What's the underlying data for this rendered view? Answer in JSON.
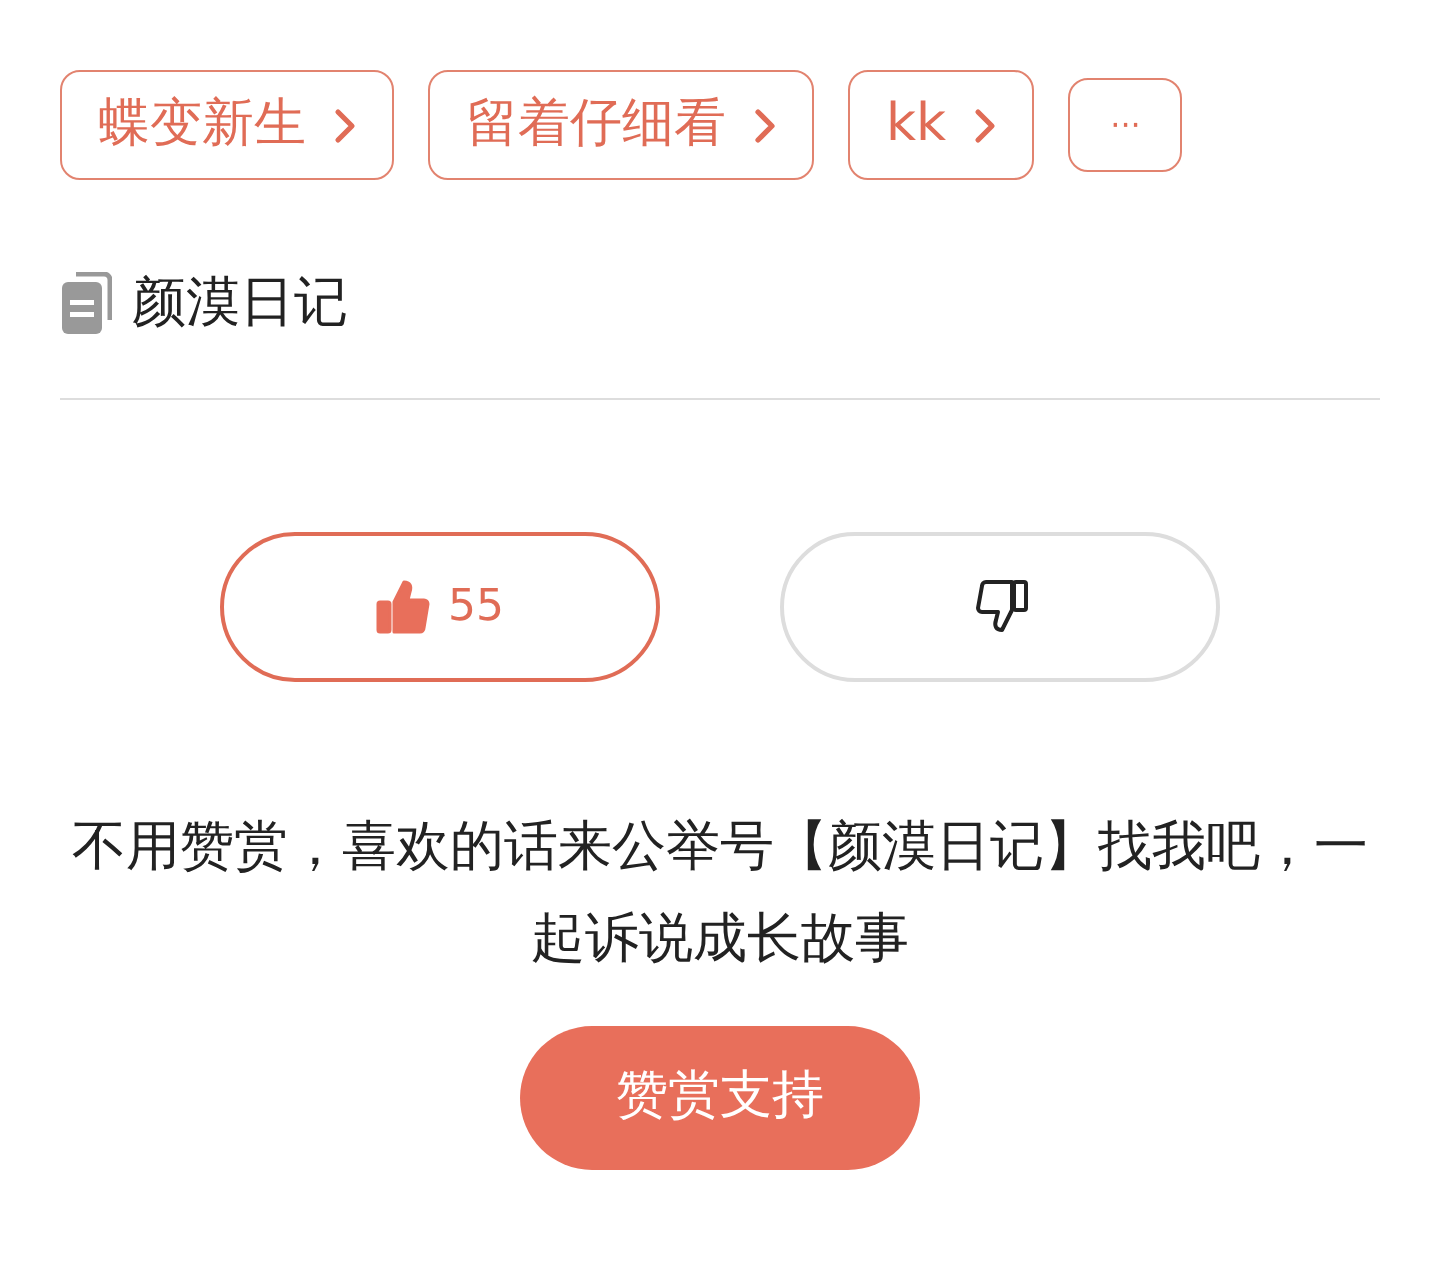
{
  "tags": [
    {
      "kind": "link",
      "label": "蝶变新生"
    },
    {
      "kind": "link",
      "label": "留着仔细看"
    },
    {
      "kind": "link",
      "label": "kk"
    },
    {
      "kind": "more",
      "label": "···"
    }
  ],
  "collection": {
    "title": "颜漠日记"
  },
  "votes": [
    {
      "kind": "like",
      "count": "55",
      "selected": true
    },
    {
      "kind": "dislike",
      "selected": false
    }
  ],
  "message": "不用赞赏，喜欢的话来公举号【颜漠日记】找我吧，一起诉说成长故事",
  "reward_button": "赞赏支持"
}
